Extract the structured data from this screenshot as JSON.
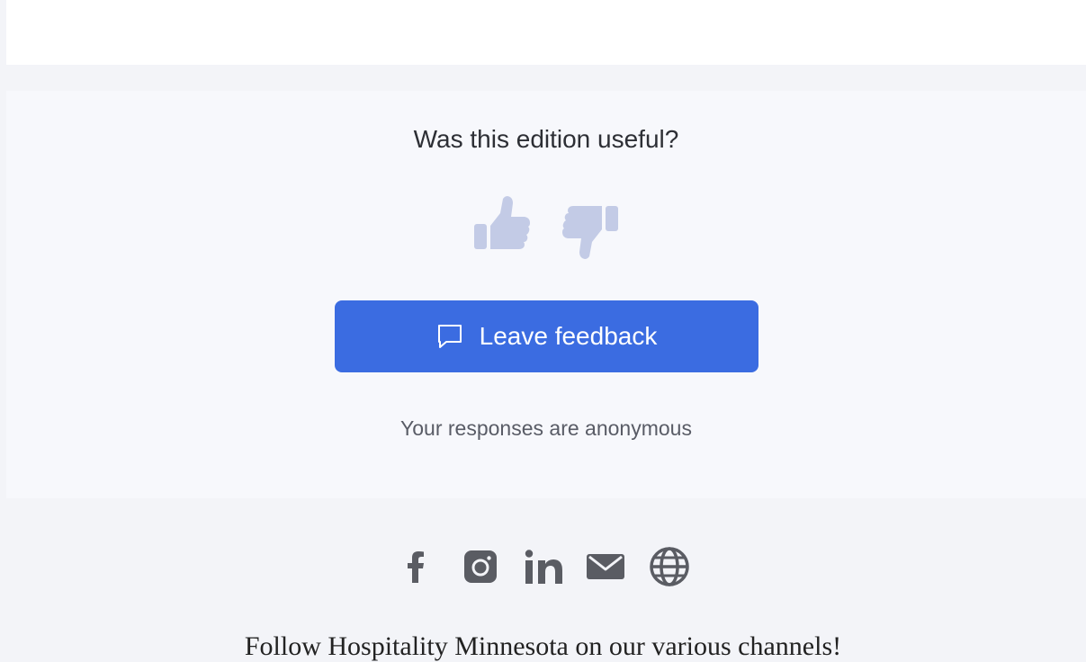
{
  "feedback": {
    "question": "Was this edition useful?",
    "button_label": "Leave feedback",
    "note": "Your responses are anonymous",
    "thumb_up_icon": "thumbs-up-icon",
    "thumb_down_icon": "thumbs-down-icon",
    "button_icon": "chat-bubble-icon"
  },
  "colors": {
    "page_bg": "#f3f4f8",
    "card_bg": "#f7f8fc",
    "button_bg": "#3b6ce1",
    "thumb_color": "#c3cbe6",
    "social_color": "#5a5c63"
  },
  "socials": [
    {
      "icon": "facebook-icon"
    },
    {
      "icon": "instagram-icon"
    },
    {
      "icon": "linkedin-icon"
    },
    {
      "icon": "email-icon"
    },
    {
      "icon": "globe-icon"
    }
  ],
  "footer": {
    "text": "Follow Hospitality Minnesota on our various channels!"
  }
}
